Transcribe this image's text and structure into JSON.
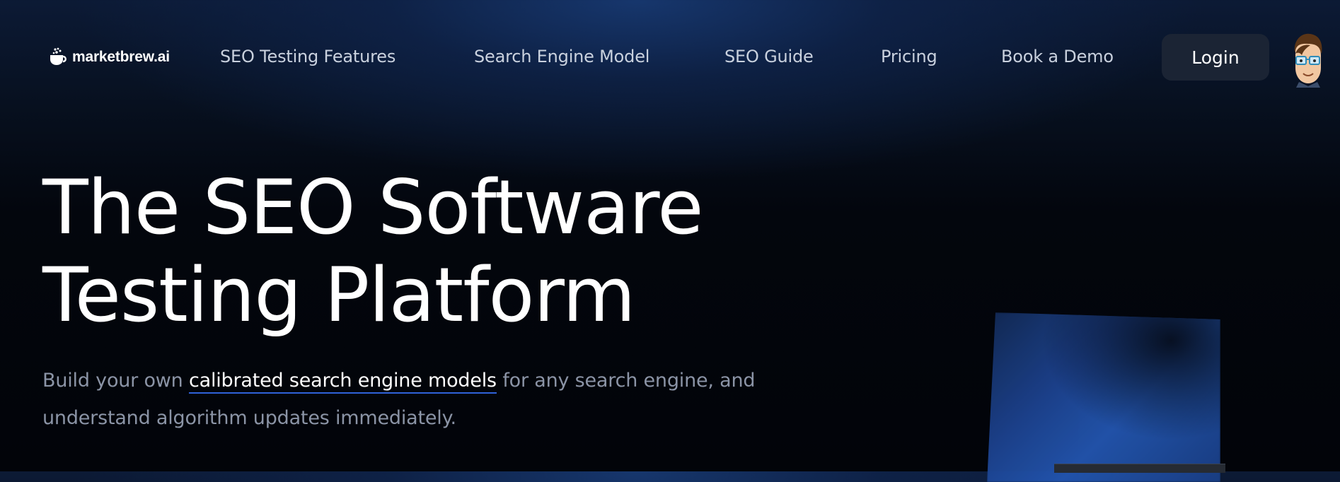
{
  "brand": {
    "name": "marketbrew.ai",
    "icon": "coffee-cup-logo-icon"
  },
  "nav": {
    "links": [
      {
        "label": "SEO Testing Features"
      },
      {
        "label": "Search Engine Model"
      },
      {
        "label": "SEO Guide"
      },
      {
        "label": "Pricing"
      },
      {
        "label": "Book a Demo"
      }
    ],
    "login_label": "Login",
    "avatar_icon": "cartoon-avatar-icon"
  },
  "hero": {
    "title_line1": "The SEO Software",
    "title_line2": "Testing Platform",
    "subtitle_before": "Build your own ",
    "subtitle_link": "calibrated search engine models",
    "subtitle_after": " for any search engine, and understand algorithm updates immediately."
  },
  "colors": {
    "background_top": "#0c1a35",
    "background_bottom": "#020409",
    "nav_text": "#c9d1de",
    "login_bg": "#1b2434",
    "subtitle_text": "#8b94a6",
    "link_underline": "#2f62d9",
    "panel_blue": "#2356b0"
  }
}
